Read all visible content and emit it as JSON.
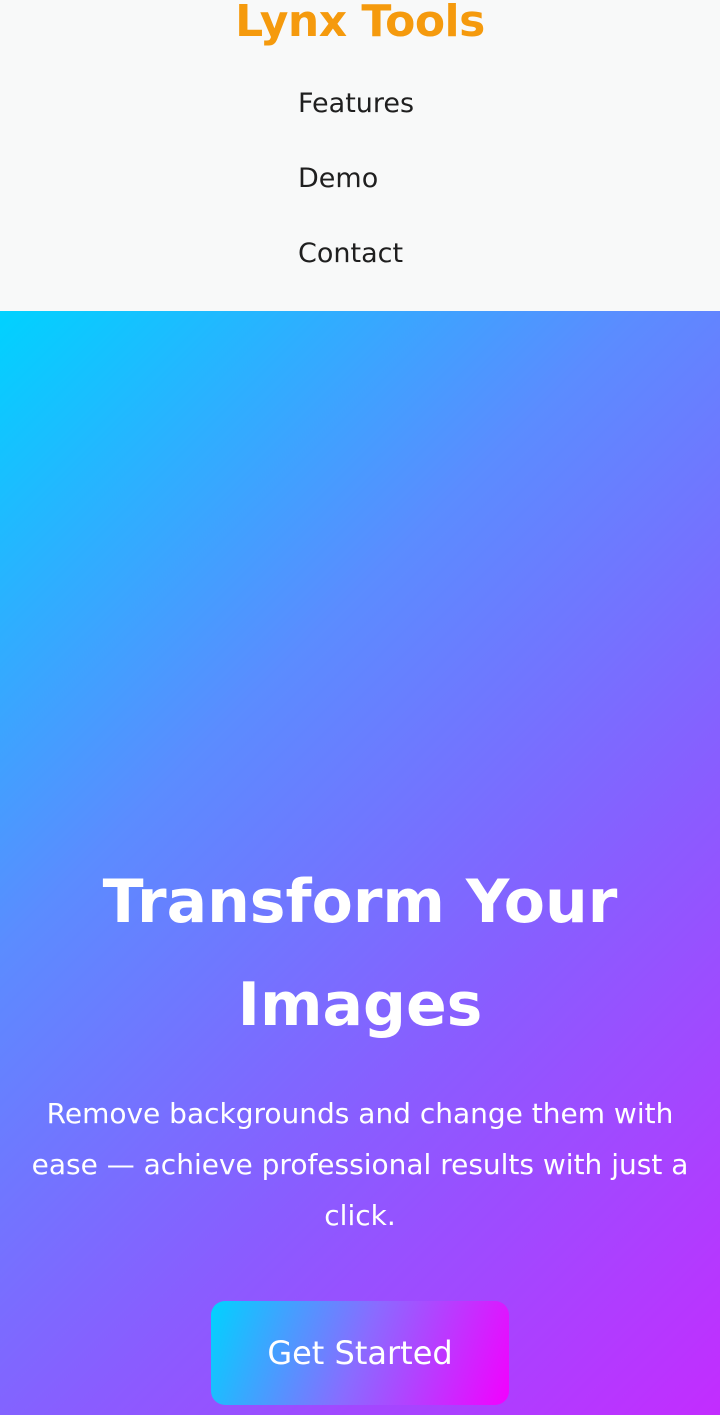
{
  "header": {
    "logo": "Lynx Tools",
    "nav": [
      {
        "label": "Features"
      },
      {
        "label": "Demo"
      },
      {
        "label": "Contact"
      }
    ]
  },
  "hero": {
    "title": "Transform Your Images",
    "subtitle": "Remove backgrounds and change them with ease — achieve professional results with just a click.",
    "cta_label": "Get Started"
  },
  "colors": {
    "logo": "#f59a0d",
    "header_bg": "#f8f9f9",
    "gradient_start": "#00d2ff",
    "gradient_end": "#c32cff",
    "text_light": "#ffffff"
  }
}
